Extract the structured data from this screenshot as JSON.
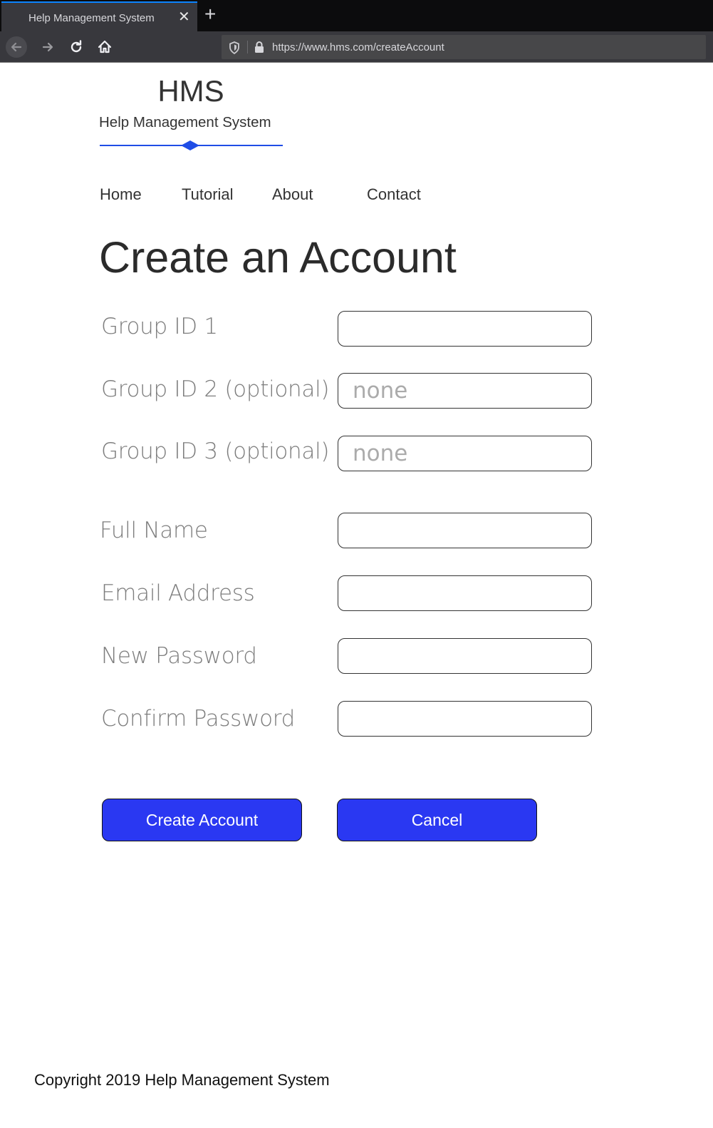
{
  "browser": {
    "tab_title": "Help Management System",
    "url": "https://www.hms.com/createAccount",
    "icons": [
      "back-arrow-icon",
      "forward-arrow-icon",
      "reload-icon",
      "home-icon",
      "shield-icon",
      "lock-icon",
      "close-icon",
      "plus-icon"
    ]
  },
  "header": {
    "logo_title": "HMS",
    "logo_subtitle": "Help Management System",
    "accent_color": "#1f4de6"
  },
  "nav": {
    "items": [
      {
        "label": "Home"
      },
      {
        "label": "Tutorial"
      },
      {
        "label": "About"
      },
      {
        "label": "Contact"
      }
    ]
  },
  "form": {
    "heading": "Create an Account",
    "fields": [
      {
        "label": "Group ID 1",
        "value": "",
        "placeholder": ""
      },
      {
        "label": "Group ID 2 (optional)",
        "value": "",
        "placeholder": "none"
      },
      {
        "label": "Group ID 3 (optional)",
        "value": "",
        "placeholder": "none"
      },
      {
        "label": "Full Name",
        "value": "",
        "placeholder": ""
      },
      {
        "label": "Email Address",
        "value": "",
        "placeholder": ""
      },
      {
        "label": "New Password",
        "value": "",
        "placeholder": ""
      },
      {
        "label": "Confirm Password",
        "value": "",
        "placeholder": ""
      }
    ],
    "create_button_label": "Create Account",
    "cancel_button_label": "Cancel",
    "button_color": "#2a38f2"
  },
  "footer": {
    "copyright": "Copyright 2019 Help Management System"
  }
}
